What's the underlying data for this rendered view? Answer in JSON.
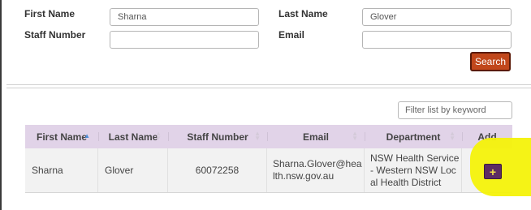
{
  "search_form": {
    "first_name_label": "First Name",
    "first_name_value": "Sharna",
    "last_name_label": "Last Name",
    "last_name_value": "Glover",
    "staff_number_label": "Staff Number",
    "staff_number_value": "",
    "email_label": "Email",
    "email_value": "",
    "search_button_label": "Search"
  },
  "results": {
    "filter_placeholder": "Filter list by keyword",
    "columns": [
      "First Name",
      "Last Name",
      "Staff Number",
      "Email",
      "Department",
      "Add"
    ],
    "rows": [
      {
        "first_name": "Sharna",
        "last_name": "Glover",
        "staff_number": "60072258",
        "email": "Sharna.Glover@health.nsw.gov.au",
        "department": "NSW Health Service - Western NSW Local Health District",
        "add_icon": "plus-icon"
      }
    ]
  },
  "colors": {
    "search_button": "#c1471b",
    "table_header": "#e1d3e8",
    "highlight": "#f4f20a",
    "add_button": "#5d2b63"
  }
}
